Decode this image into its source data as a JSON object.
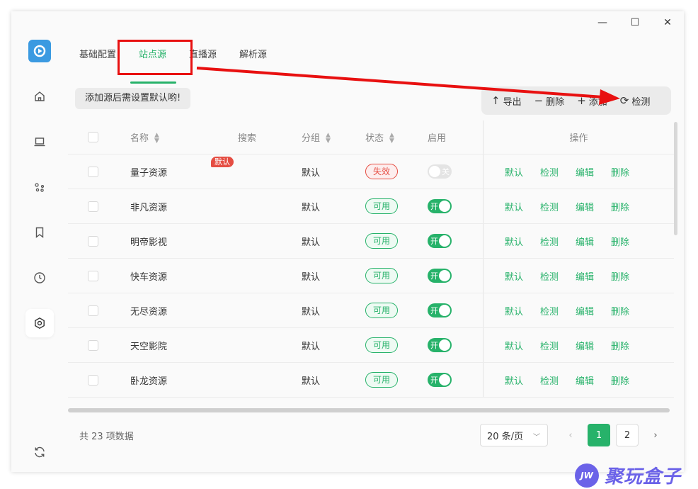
{
  "window": {
    "minimize": "—",
    "maximize": "☐",
    "close": "✕"
  },
  "tabs": [
    {
      "label": "基础配置"
    },
    {
      "label": "站点源"
    },
    {
      "label": "直播源"
    },
    {
      "label": "解析源"
    }
  ],
  "hint": "添加源后需设置默认哟!",
  "toolbar": {
    "export": "导出",
    "delete": "删除",
    "add": "添加",
    "check": "检测"
  },
  "table": {
    "headers": {
      "name": "名称",
      "search": "搜索",
      "group": "分组",
      "status": "状态",
      "enabled": "启用",
      "ops": "操作"
    },
    "rows": [
      {
        "name": "量子资源",
        "badge": "默认",
        "group": "默认",
        "status": "失效",
        "enabled": "关"
      },
      {
        "name": "非凡资源",
        "group": "默认",
        "status": "可用",
        "enabled": "开"
      },
      {
        "name": "明帝影视",
        "group": "默认",
        "status": "可用",
        "enabled": "开"
      },
      {
        "name": "快车资源",
        "group": "默认",
        "status": "可用",
        "enabled": "开"
      },
      {
        "name": "无尽资源",
        "group": "默认",
        "status": "可用",
        "enabled": "开"
      },
      {
        "name": "天空影院",
        "group": "默认",
        "status": "可用",
        "enabled": "开"
      },
      {
        "name": "卧龙资源",
        "group": "默认",
        "status": "可用",
        "enabled": "开"
      }
    ],
    "ops": {
      "default": "默认",
      "check": "检测",
      "edit": "编辑",
      "delete": "删除"
    }
  },
  "pagination": {
    "total": "共 23 项数据",
    "page_size": "20 条/页",
    "pages": [
      "1",
      "2"
    ],
    "current": "1"
  },
  "watermark": {
    "logo": "JW",
    "text": "聚玩盒子"
  },
  "colors": {
    "accent": "#27b26a",
    "danger": "#e54d42",
    "annotation": "#e81010"
  }
}
